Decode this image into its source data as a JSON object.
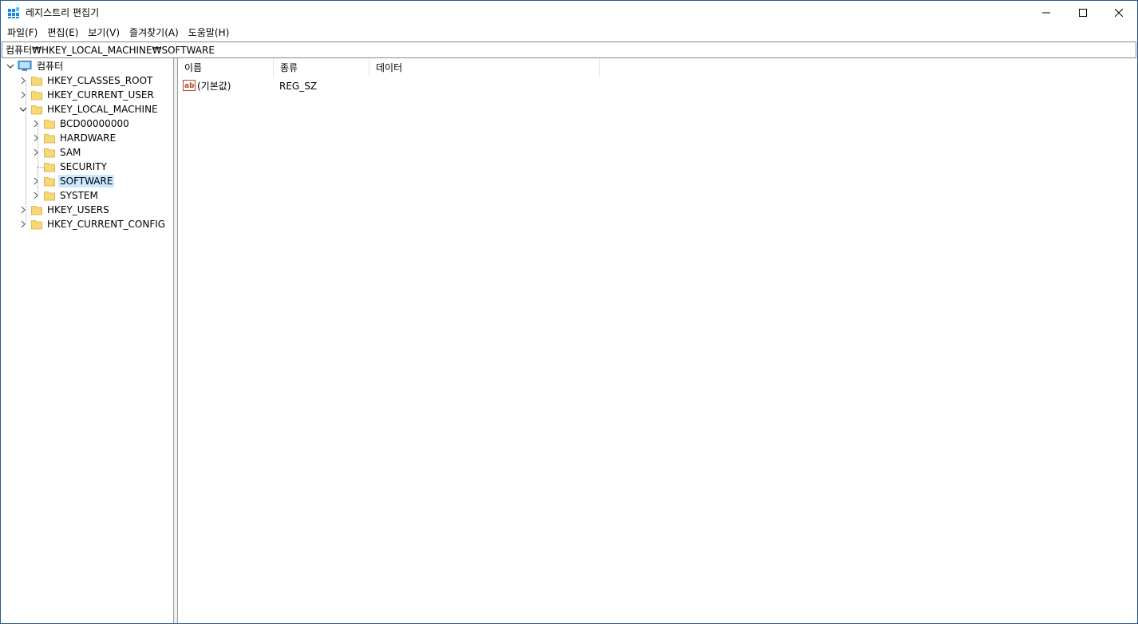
{
  "window": {
    "title": "레지스트리 편집기"
  },
  "menu": [
    "파일(F)",
    "편집(E)",
    "보기(V)",
    "즐겨찾기(A)",
    "도움말(H)"
  ],
  "address": "컴퓨터₩HKEY_LOCAL_MACHINE₩SOFTWARE",
  "tree": {
    "root": "컴퓨터",
    "hives": [
      "HKEY_CLASSES_ROOT",
      "HKEY_CURRENT_USER",
      "HKEY_LOCAL_MACHINE",
      "HKEY_USERS",
      "HKEY_CURRENT_CONFIG"
    ],
    "hklm_children": [
      "BCD00000000",
      "HARDWARE",
      "SAM",
      "SECURITY",
      "SOFTWARE",
      "SYSTEM"
    ],
    "selected": "SOFTWARE"
  },
  "list": {
    "columns": [
      "이름",
      "종류",
      "데이터"
    ],
    "rows": [
      {
        "name": "(기본값)",
        "type": "REG_SZ",
        "data": ""
      }
    ]
  },
  "colors": {
    "selection": "#cce8ff",
    "folder": "#f8d775",
    "icon_blue": "#1e88e5"
  }
}
